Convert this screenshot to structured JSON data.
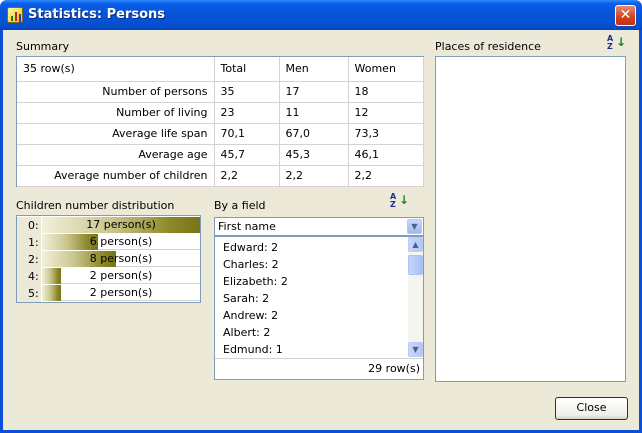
{
  "window": {
    "title": "Statistics: Persons",
    "close_glyph": "✕"
  },
  "summary": {
    "label": "Summary",
    "headers": [
      "35 row(s)",
      "Total",
      "Men",
      "Women"
    ],
    "rows": [
      [
        "Number of persons",
        "35",
        "17",
        "18"
      ],
      [
        "Number of living",
        "23",
        "11",
        "12"
      ],
      [
        "Average life span",
        "70,1",
        "67,0",
        "73,3"
      ],
      [
        "Average age",
        "45,7",
        "45,3",
        "46,1"
      ],
      [
        "Average number of children",
        "2,2",
        "2,2",
        "2,2"
      ]
    ]
  },
  "children_distribution": {
    "label": "Children number distribution",
    "max": 17,
    "rows": [
      {
        "key": "0:",
        "count": 17,
        "text": "17 person(s)"
      },
      {
        "key": "1:",
        "count": 6,
        "text": "6 person(s)"
      },
      {
        "key": "2:",
        "count": 8,
        "text": "8 person(s)"
      },
      {
        "key": "4:",
        "count": 2,
        "text": "2 person(s)"
      },
      {
        "key": "5:",
        "count": 2,
        "text": "2 person(s)"
      }
    ]
  },
  "by_field": {
    "label": "By a field",
    "sort_icon": "sort-az-icon",
    "selected_field": "First name",
    "items": [
      "Edward: 2",
      "Charles: 2",
      "Elizabeth: 2",
      "Sarah: 2",
      "Andrew: 2",
      "Albert: 2",
      "Edmund: 1"
    ],
    "row_count": "29 row(s)"
  },
  "residence": {
    "label": "Places of residence",
    "sort_icon": "sort-az-icon"
  },
  "buttons": {
    "close": "Close"
  },
  "colors": {
    "title_bar": "#0653d8",
    "dialog_bg": "#ece9d8",
    "bar_dark": "#777418",
    "border": "#7f9db9"
  }
}
